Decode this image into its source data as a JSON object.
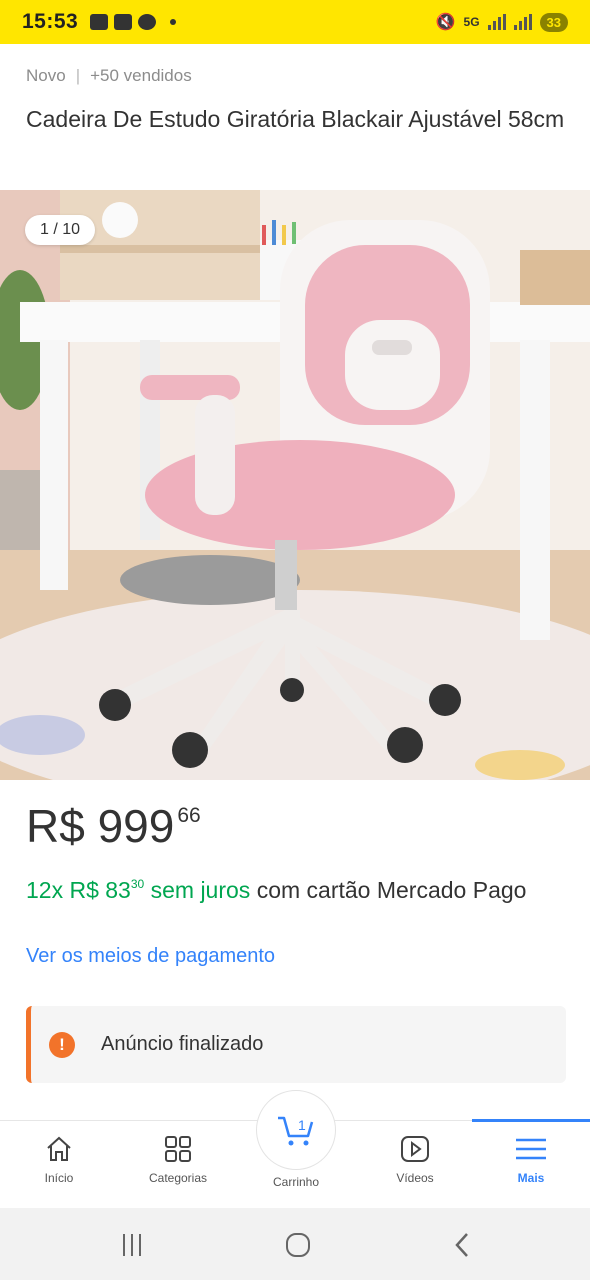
{
  "status": {
    "time": "15:53",
    "network": "5G",
    "battery": "33"
  },
  "product": {
    "condition": "Novo",
    "sold": "+50 vendidos",
    "title": "Cadeira De Estudo Giratória Blackair Ajustável 58cm",
    "image_counter": "1 / 10"
  },
  "price": {
    "main": "R$ 999",
    "cents": "66"
  },
  "installments": {
    "prefix": "12x R$ 83",
    "cents": "30",
    "interest": "sem juros",
    "suffix": "com cartão Mercado Pago"
  },
  "payment_link": "Ver os meios de pagamento",
  "alert": {
    "text": "Anúncio finalizado"
  },
  "tabs": [
    {
      "label": "Início",
      "icon": "home-icon"
    },
    {
      "label": "Categorias",
      "icon": "grid-icon"
    },
    {
      "label": "Carrinho",
      "icon": "cart-icon",
      "badge": "1"
    },
    {
      "label": "Vídeos",
      "icon": "play-icon"
    },
    {
      "label": "Mais",
      "icon": "menu-icon",
      "active": true
    }
  ],
  "colors": {
    "brand_yellow": "#ffe600",
    "link_blue": "#3483fa",
    "green": "#00a650",
    "warning_orange": "#f2732a"
  }
}
